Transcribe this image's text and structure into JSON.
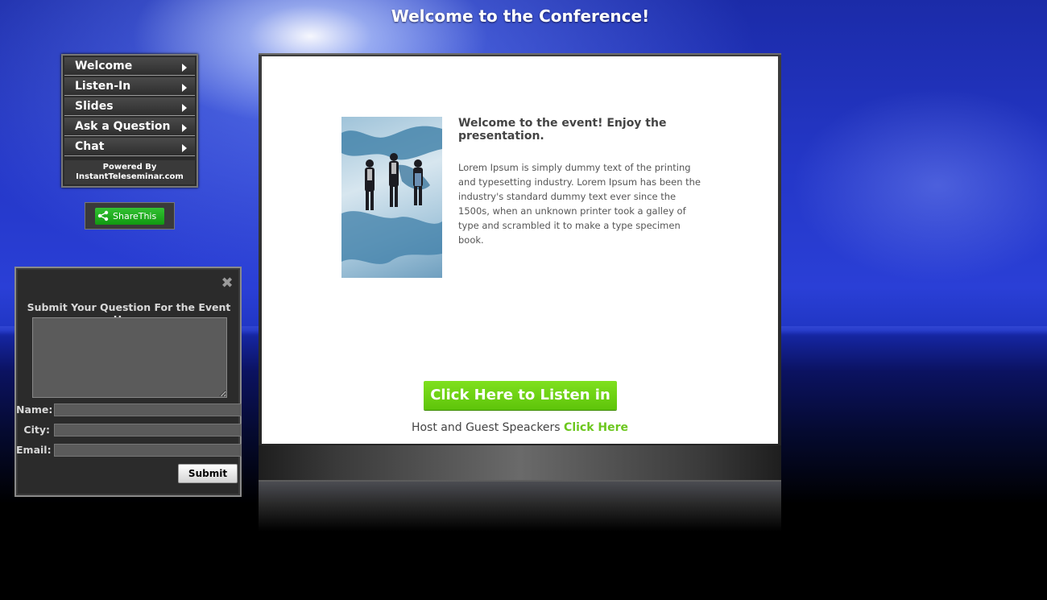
{
  "page": {
    "title": "Welcome to the Conference!"
  },
  "nav": {
    "items": [
      {
        "label": "Welcome"
      },
      {
        "label": "Listen-In"
      },
      {
        "label": "Slides"
      },
      {
        "label": "Ask a Question"
      },
      {
        "label": "Chat"
      }
    ],
    "powered_line1": "Powered By",
    "powered_line2": "InstantTeleseminar.com"
  },
  "share": {
    "label": "ShareThis",
    "icon": "share-icon",
    "color": "#1faa1f"
  },
  "question_panel": {
    "heading": "Submit Your Question For the Event Here:",
    "fields": {
      "name_label": "Name:",
      "city_label": "City:",
      "email_label": "Email:",
      "name_value": "",
      "city_value": "",
      "email_value": "",
      "question_value": ""
    },
    "submit_label": "Submit",
    "close_icon": "close-icon"
  },
  "content": {
    "welcome_heading": "Welcome to the event! Enjoy the presentation.",
    "welcome_body": "Lorem Ipsum is simply dummy text of the printing and typesetting industry. Lorem Ipsum has been the industry's standard dummy text ever since the 1500s, when an unknown printer took a galley of type and scrambled it to make a type specimen book.",
    "listen_button_label": "Click Here to Listen in",
    "host_text": "Host and Guest Speackers",
    "host_link_label": "Click Here",
    "accent_color": "#6cc71e"
  }
}
